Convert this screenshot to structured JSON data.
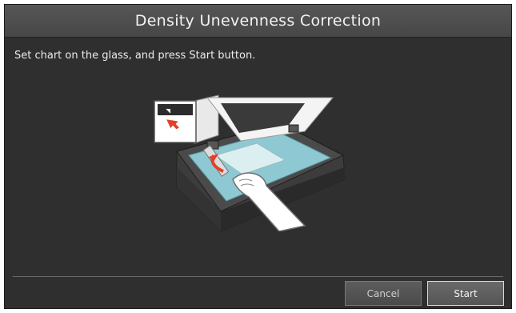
{
  "dialog": {
    "title": "Density Unevenness Correction",
    "instruction": "Set chart on the glass, and press Start button.",
    "illustration_icon": "scanner-place-chart-illustration"
  },
  "buttons": {
    "cancel_label": "Cancel",
    "start_label": "Start"
  },
  "colors": {
    "background": "#2f2f2f",
    "titlebar": "#4f4f4f",
    "text": "#ececec",
    "accent_arrow": "#e3402b",
    "glass": "#8ec9d3"
  }
}
